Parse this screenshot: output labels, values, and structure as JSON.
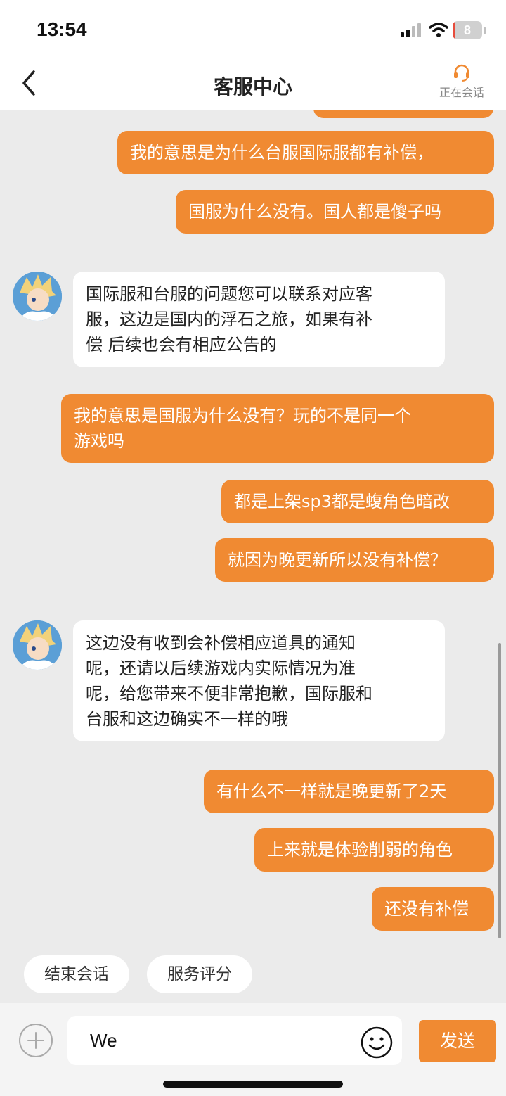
{
  "status_bar": {
    "time": "13:54",
    "battery_level": "8",
    "battery_fraction": 0.08,
    "icons": [
      "signal-icon",
      "wifi-icon",
      "battery-icon"
    ]
  },
  "header": {
    "title": "客服中心",
    "session_status": "正在会话",
    "icons": [
      "back-chevron-icon",
      "headset-icon"
    ]
  },
  "messages": [
    {
      "sender": "user",
      "text": "我的意思是为什么台服国际服都有补偿，"
    },
    {
      "sender": "user",
      "text": "国服为什么没有。国人都是傻子吗"
    },
    {
      "sender": "agent",
      "text": "国际服和台服的问题您可以联系对应客\n服，这边是国内的浮石之旅，如果有补\n偿 后续也会有相应公告的"
    },
    {
      "sender": "user",
      "text": "我的意思是国服为什么没有？玩的不是同一个\n游戏吗"
    },
    {
      "sender": "user",
      "text": "都是上架sp3都是蝮角色暗改"
    },
    {
      "sender": "user",
      "text": "就因为晚更新所以没有补偿？"
    },
    {
      "sender": "agent",
      "text": "这边没有收到会补偿相应道具的通知\n呢，还请以后续游戏内实际情况为准\n呢，给您带来不便非常抱歉，国际服和\n台服和这边确实不一样的哦"
    },
    {
      "sender": "user",
      "text": "有什么不一样就是晚更新了2天"
    },
    {
      "sender": "user",
      "text": "上来就是体验削弱的角色"
    },
    {
      "sender": "user",
      "text": "还没有补偿"
    }
  ],
  "quick_actions": {
    "end_session": "结束会话",
    "rate_service": "服务评分"
  },
  "input": {
    "value": "We",
    "send_label": "发送",
    "icons": [
      "plus-icon",
      "emoji-icon"
    ]
  },
  "colors": {
    "accent": "#f08a32",
    "background": "#ebebeb",
    "agent_bubble": "#ffffff"
  }
}
